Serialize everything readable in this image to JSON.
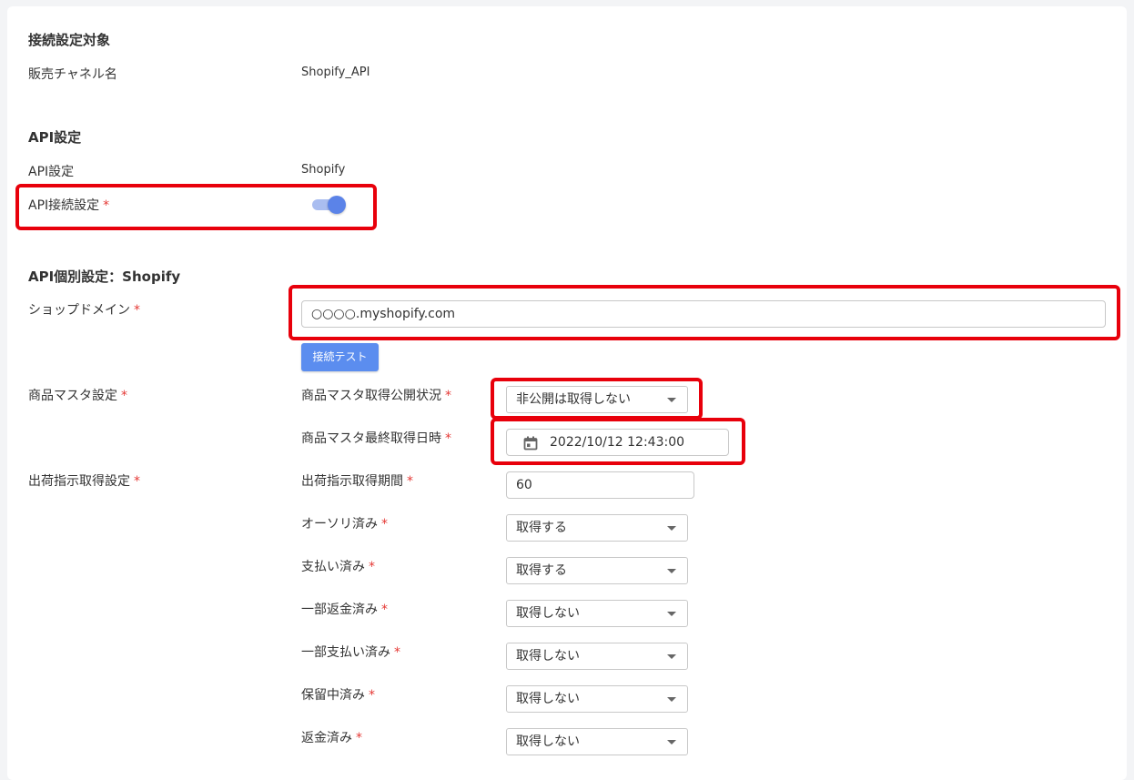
{
  "target_section": {
    "title": "接続設定対象",
    "channel_label": "販売チャネル名",
    "channel_value": "Shopify_API"
  },
  "api_section": {
    "title": "API設定",
    "api_label": "API設定",
    "api_value": "Shopify",
    "connection_label": "API接続設定",
    "required_mark": "*",
    "connection_enabled": true
  },
  "individual_section": {
    "title": "API個別設定：Shopify",
    "domain_label": "ショップドメイン",
    "domain_value": "○○○○.myshopify.com",
    "test_button": "接続テスト",
    "product_master_label": "商品マスタ設定",
    "publish_status_label": "商品マスタ取得公開状況",
    "publish_status_value": "非公開は取得しない",
    "last_fetch_label": "商品マスタ最終取得日時",
    "last_fetch_value": "2022/10/12 12:43:00",
    "shipping_label": "出荷指示取得設定",
    "period_label": "出荷指示取得期間",
    "period_value": "60",
    "order_rows": [
      {
        "label": "オーソリ済み",
        "value": "取得する"
      },
      {
        "label": "支払い済み",
        "value": "取得する"
      },
      {
        "label": "一部返金済み",
        "value": "取得しない"
      },
      {
        "label": "一部支払い済み",
        "value": "取得しない"
      },
      {
        "label": "保留中済み",
        "value": "取得しない"
      },
      {
        "label": "返金済み",
        "value": "取得しない"
      }
    ]
  },
  "colors": {
    "highlight": "#e8000b",
    "accent": "#5b8def",
    "required": "#e53935"
  }
}
